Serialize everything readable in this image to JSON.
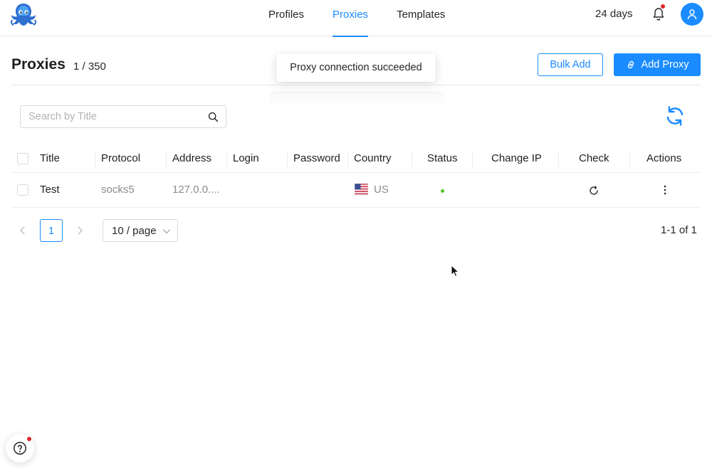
{
  "nav": {
    "items": [
      {
        "label": "Profiles",
        "active": false
      },
      {
        "label": "Proxies",
        "active": true
      },
      {
        "label": "Templates",
        "active": false
      }
    ],
    "subscription_days": "24 days",
    "accent_color": "#1a8cff",
    "logo_icon": "octopus-logo-icon"
  },
  "header": {
    "title": "Proxies",
    "count": "1 / 350",
    "bulk_add_label": "Bulk Add",
    "add_proxy_label": "Add Proxy"
  },
  "toast": {
    "message": "Proxy connection succeeded"
  },
  "search": {
    "placeholder": "Search by Title",
    "value": ""
  },
  "table": {
    "columns": [
      "Title",
      "Protocol",
      "Address",
      "Login",
      "Password",
      "Country",
      "Status",
      "Change IP",
      "Check",
      "Actions"
    ],
    "rows": [
      {
        "title": "Test",
        "protocol": "socks5",
        "address": "127.0.0....",
        "login": "",
        "password": "",
        "country_code": "US",
        "country_flag_icon": "us-flag-icon",
        "status": "online",
        "status_color": "#52c41a",
        "change_ip": ""
      }
    ]
  },
  "pagination": {
    "current_page": "1",
    "page_size": "10 / page",
    "total_text": "1-1 of 1"
  }
}
